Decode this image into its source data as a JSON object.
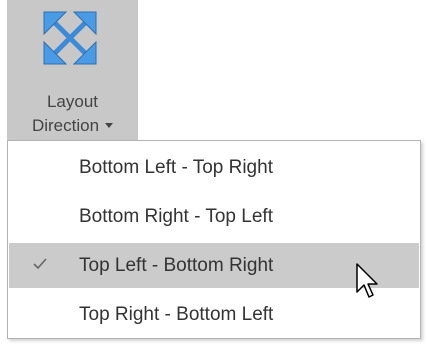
{
  "ribbon": {
    "label_line1": "Layout",
    "label_line2": "Direction",
    "icon": "expand-arrows-icon"
  },
  "menu": {
    "items": [
      {
        "label": "Bottom Left - Top Right",
        "checked": false
      },
      {
        "label": "Bottom Right - Top Left",
        "checked": false
      },
      {
        "label": "Top Left - Bottom Right",
        "checked": true
      },
      {
        "label": "Top Right - Bottom Left",
        "checked": false
      }
    ]
  },
  "colors": {
    "ribbon_bg": "#c8c8c8",
    "selected_bg": "#cbcbcb",
    "icon_blue": "#3d8bd8"
  }
}
